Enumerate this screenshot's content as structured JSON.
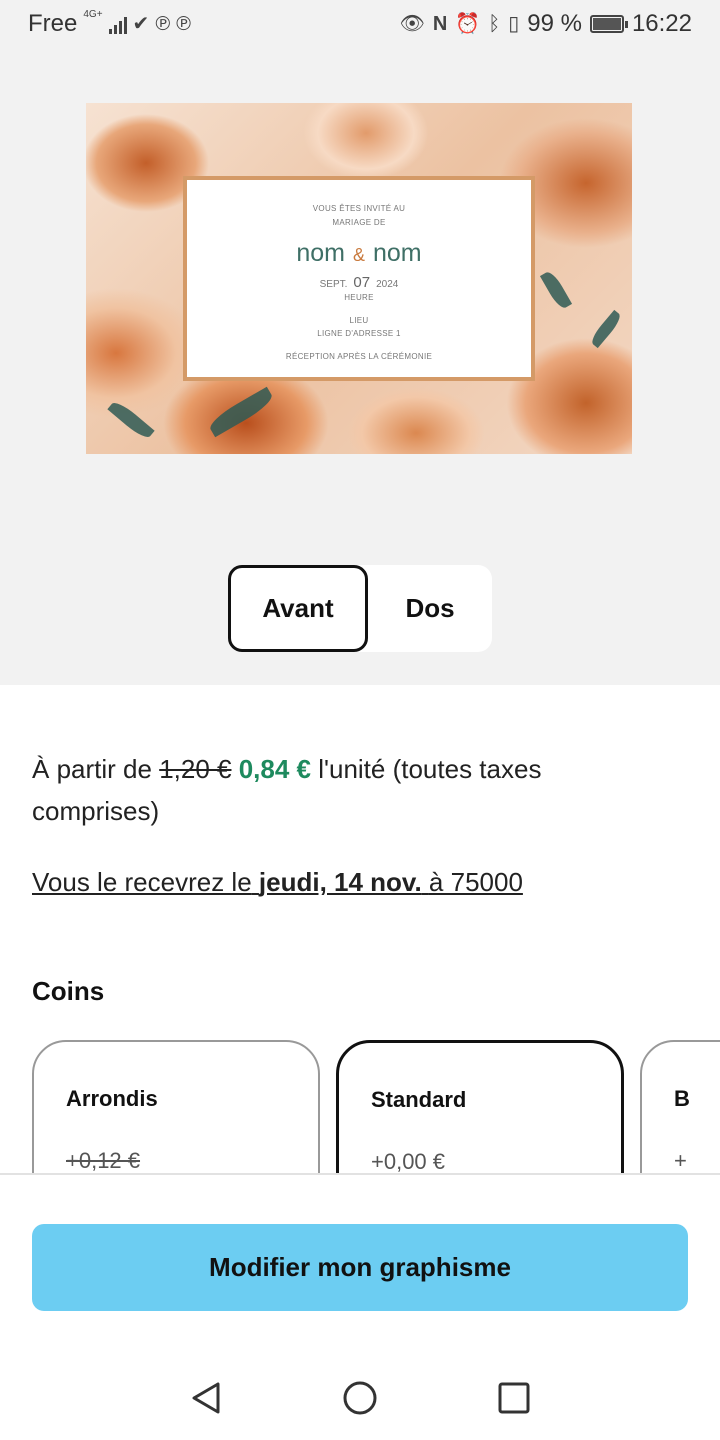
{
  "status_bar": {
    "carrier": "Free",
    "network": "4G+",
    "battery": "99 %",
    "time": "16:22"
  },
  "card": {
    "line1": "VOUS ÊTES INVITÉ AU",
    "line2": "MARIAGE DE",
    "name1": "nom",
    "ampersand": "&",
    "name2": "nom",
    "month": "SEPT.",
    "day": "07",
    "year": "2024",
    "hour": "HEURE",
    "place": "LIEU",
    "address": "LIGNE D'ADRESSE 1",
    "reception": "RÉCEPTION APRÈS LA CÉRÉMONIE"
  },
  "side_toggle": {
    "front": "Avant",
    "back": "Dos"
  },
  "price": {
    "prefix": "À partir de",
    "old": "1,20 €",
    "new": "0,84 €",
    "suffix": "l'unité (toutes taxes comprises)"
  },
  "delivery": {
    "prefix": "Vous le recevrez le",
    "date": "jeudi, 14 nov.",
    "suffix": "à 75000"
  },
  "corners": {
    "title": "Coins",
    "options": [
      {
        "name": "Arrondis",
        "price": "+0,12 €",
        "struck": true
      },
      {
        "name": "Standard",
        "price": "+0,00 €",
        "selected": true
      },
      {
        "name": "B",
        "price": "+"
      }
    ]
  },
  "cta": {
    "label": "Modifier mon graphisme",
    "color": "#6ccdf2"
  },
  "colors": {
    "price_green": "#1e8a5e",
    "card_border": "#d49a67",
    "names": "#3f6f66"
  }
}
